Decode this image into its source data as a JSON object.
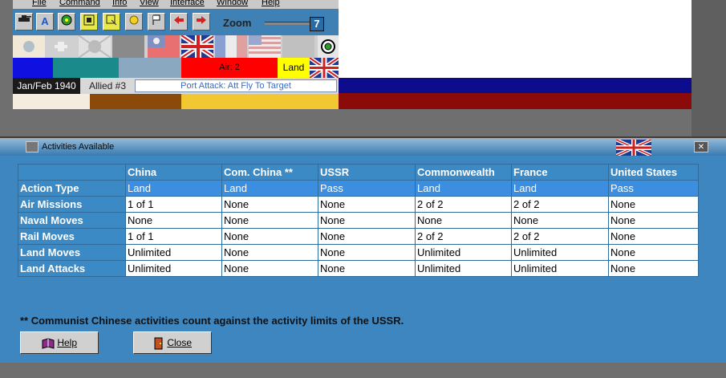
{
  "menu": [
    "File",
    "Command",
    "Info",
    "View",
    "Interface",
    "Window",
    "Help"
  ],
  "toolbar": {
    "zoom_label": "Zoom",
    "zoom_value": "7"
  },
  "info": {
    "air_label": "Air: 2",
    "land_label": "Land"
  },
  "status": {
    "date": "Jan/Feb 1940",
    "impulse": "Allied #3",
    "mission": "Port Attack: Att Fly To Target"
  },
  "dialog": {
    "title": "Activities Available",
    "columns": [
      "China",
      "Com. China **",
      "USSR",
      "Commonwealth",
      "France",
      "United States"
    ],
    "rows": [
      {
        "label": "Action Type",
        "cells": [
          "Land",
          "Land",
          "Pass",
          "Land",
          "Land",
          "Pass"
        ]
      },
      {
        "label": "Air Missions",
        "cells": [
          "1 of 1",
          "None",
          "None",
          "2 of 2",
          "2 of 2",
          "None"
        ]
      },
      {
        "label": "Naval Moves",
        "cells": [
          "None",
          "None",
          "None",
          "None",
          "None",
          "None"
        ]
      },
      {
        "label": "Rail Moves",
        "cells": [
          "1 of 1",
          "None",
          "None",
          "2 of 2",
          "2 of 2",
          "None"
        ]
      },
      {
        "label": "Land Moves",
        "cells": [
          "Unlimited",
          "None",
          "None",
          "Unlimited",
          "Unlimited",
          "None"
        ]
      },
      {
        "label": "Land Attacks",
        "cells": [
          "Unlimited",
          "None",
          "None",
          "Unlimited",
          "Unlimited",
          "None"
        ]
      }
    ],
    "footnote": "** Communist Chinese activities count against the activity limits of the USSR.",
    "help_label": "Help",
    "close_label": "Close"
  },
  "icons": [
    "tank-icon",
    "text-icon",
    "settings-icon",
    "grid-icon",
    "zoom-icon",
    "star-icon",
    "flag-icon",
    "arrow-left-icon",
    "arrow-right-icon",
    "book-icon",
    "door-icon",
    "target-icon",
    "uk-flag-icon"
  ],
  "colors": {
    "dialog_bg": "#3e86bf",
    "header_bg": "#3b8ac6",
    "selected_row": "#3c8fe0"
  }
}
